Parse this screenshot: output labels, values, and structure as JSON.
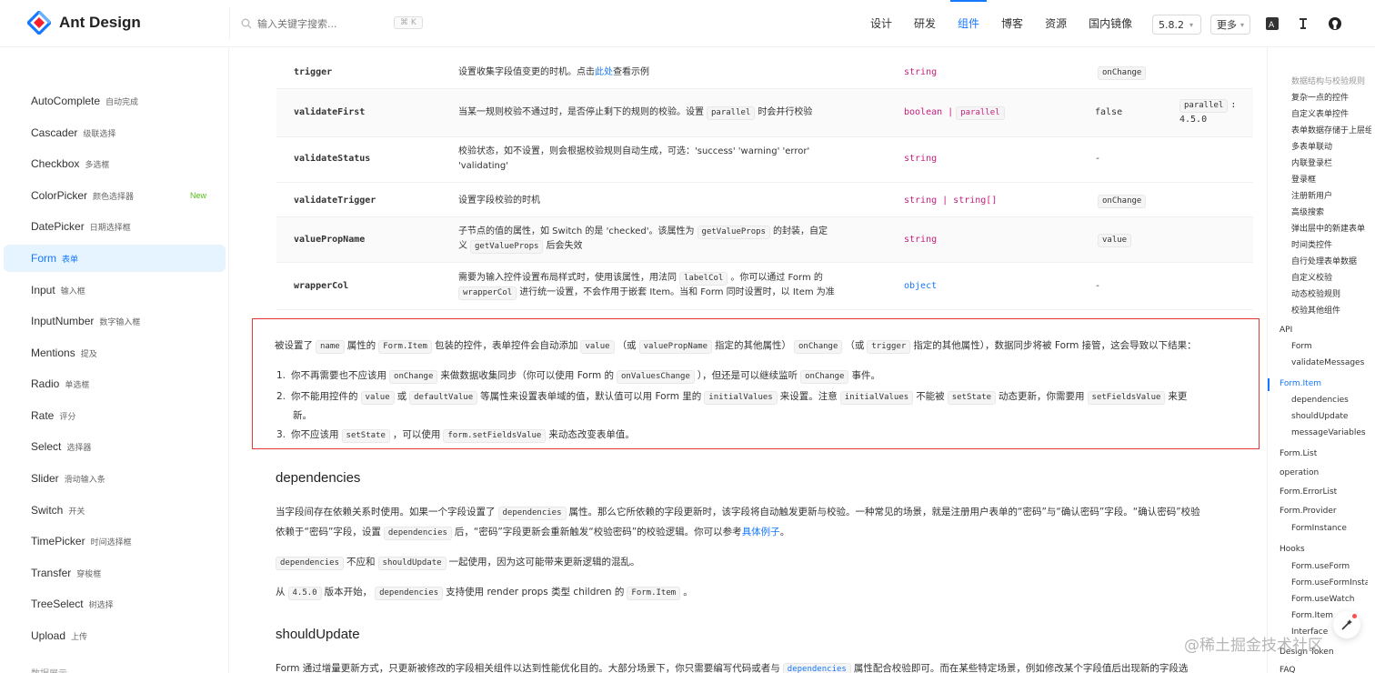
{
  "header": {
    "brand": "Ant Design",
    "search_placeholder": "输入关键字搜索...",
    "kbd": "⌘ K",
    "nav": [
      "设计",
      "研发",
      "组件",
      "博客",
      "资源",
      "国内镜像"
    ],
    "active_nav": "组件",
    "version": "5.8.2",
    "more": "更多",
    "brand_color": "#1677ff",
    "icons": [
      "language-icon",
      "direction-icon",
      "github-icon"
    ]
  },
  "sidebar": {
    "items": [
      {
        "label": "AutoComplete",
        "cn": "自动完成"
      },
      {
        "label": "Cascader",
        "cn": "级联选择"
      },
      {
        "label": "Checkbox",
        "cn": "多选框"
      },
      {
        "label": "ColorPicker",
        "cn": "颜色选择器",
        "badge": "New"
      },
      {
        "label": "DatePicker",
        "cn": "日期选择框"
      },
      {
        "label": "Form",
        "cn": "表单"
      },
      {
        "label": "Input",
        "cn": "输入框"
      },
      {
        "label": "InputNumber",
        "cn": "数字输入框"
      },
      {
        "label": "Mentions",
        "cn": "提及"
      },
      {
        "label": "Radio",
        "cn": "单选框"
      },
      {
        "label": "Rate",
        "cn": "评分"
      },
      {
        "label": "Select",
        "cn": "选择器"
      },
      {
        "label": "Slider",
        "cn": "滑动输入条"
      },
      {
        "label": "Switch",
        "cn": "开关"
      },
      {
        "label": "TimePicker",
        "cn": "时间选择框"
      },
      {
        "label": "Transfer",
        "cn": "穿梭框"
      },
      {
        "label": "TreeSelect",
        "cn": "树选择"
      },
      {
        "label": "Upload",
        "cn": "上传"
      },
      {
        "label": "数据展示",
        "cn": ""
      }
    ],
    "active": "Form"
  },
  "table": {
    "rows": [
      {
        "prop": "trigger",
        "desc_a": "设置收集字段值变更的时机。点击",
        "desc_link": "此处",
        "desc_b": "查看示例",
        "type": "string",
        "default": "onChange",
        "version": ""
      },
      {
        "prop": "validateFirst",
        "desc_a": "当某一规则校验不通过时，是否停止剩下的规则的校验。设置",
        "code_a": "parallel",
        "desc_b": "时会并行校验",
        "type_a": "boolean |",
        "type_code": "parallel",
        "default": "false",
        "version_code": "parallel",
        "version_b": ":",
        "version_c": "4.5.0"
      },
      {
        "prop": "validateStatus",
        "line1": "校验状态，如不设置，则会根据校验规则自动生成，可选：'success' 'warning' 'error'",
        "line2": "'validating'",
        "type": "string",
        "default": "-"
      },
      {
        "prop": "validateTrigger",
        "desc": "设置字段校验的时机",
        "type": "string | string[]",
        "default": "onChange"
      },
      {
        "prop": "valuePropName",
        "line1a": "子节点的值的属性，如 Switch 的是 'checked'。该属性为",
        "code1": "getValueProps",
        "line1b": "的封装，自定",
        "line2a": "义",
        "code2": "getValueProps",
        "line2b": "后会失效",
        "type": "string",
        "default": "value"
      },
      {
        "prop": "wrapperCol",
        "line1a": "需要为输入控件设置布局样式时，使用该属性，用法同",
        "code1": "labelCol",
        "line1b": "。你可以通过 Form 的",
        "code2": "wrapperCol",
        "line2b": "进行统一设置，不会作用于嵌套 Item。当和 Form 同时设置时，以 Item 为准",
        "type": "object",
        "default": "-"
      }
    ]
  },
  "notice": {
    "intro": [
      "被设置了",
      "name",
      "属性的",
      "Form.Item",
      "包装的控件，表单控件会自动添加",
      "value",
      "（或",
      "valuePropName",
      "指定的其他属性）",
      "onChange",
      "（或",
      "trigger",
      "指定的其他属性），数据同步将被 Form 接管，这会导致以下结果："
    ],
    "li1": [
      "你不再需要也不应该用",
      "onChange",
      "来做数据收集同步（你可以使用 Form 的",
      "onValuesChange",
      "），但还是可以继续监听",
      "onChange",
      "事件。"
    ],
    "li2": [
      "你不能用控件的",
      "value",
      "或",
      "defaultValue",
      "等属性来设置表单域的值，默认值可以用 Form 里的",
      "initialValues",
      "来设置。注意",
      "initialValues",
      "不能被",
      "setState",
      "动态更新，你需要用",
      "setFieldsValue",
      "来更"
    ],
    "li2b": "新。",
    "li3": [
      "你不应该用",
      "setState",
      "，可以使用",
      "form.setFieldsValue",
      "来动态改变表单值。"
    ],
    "nums": [
      "1.",
      "2.",
      "3."
    ]
  },
  "dependencies": {
    "title": "dependencies",
    "p1a": "当字段间存在依赖关系时使用。如果一个字段设置了",
    "p1code": "dependencies",
    "p1b": "属性。那么它所依赖的字段更新时，该字段将自动触发更新与校验。一种常见的场景，就是注册用户表单的“密码”与“确认密码”字段。“确认密码”校验",
    "p2a": "依赖于“密码”字段，设置",
    "p2code": "dependencies",
    "p2b": "后，“密码”字段更新会重新触发“校验密码”的校验逻辑。你可以参考",
    "p2link": "具体例子",
    "p2c": "。",
    "p3code1": "dependencies",
    "p3a": "不应和",
    "p3code2": "shouldUpdate",
    "p3b": "一起使用，因为这可能带来更新逻辑的混乱。",
    "p4a": "从",
    "p4code1": "4.5.0",
    "p4b": "版本开始，",
    "p4code2": "dependencies",
    "p4c": "支持使用 render props 类型 children 的",
    "p4code3": "Form.Item",
    "p4d": "。"
  },
  "shouldUpdate": {
    "title": "shouldUpdate",
    "p1a": "Form 通过增量更新方式，只更新被修改的字段相关组件以达到性能优化目的。大部分场景下，你只需要编写代码或者与",
    "p1code": "dependencies",
    "p1b": "属性配合校验即可。而在某些特定场景，例如修改某个字段值后出现新的字段选"
  },
  "toc": {
    "items": [
      "数据结构与校验规则",
      "复杂一点的控件",
      "自定义表单控件",
      "表单数据存储于上层组件",
      "多表单联动",
      "内联登录栏",
      "登录框",
      "注册新用户",
      "高级搜索",
      "弹出层中的新建表单",
      "时间类控件",
      "自行处理表单数据",
      "自定义校验",
      "动态校验规则",
      "校验其他组件",
      "API",
      "Form",
      "validateMessages",
      "Form.Item",
      "dependencies",
      "shouldUpdate",
      "messageVariables",
      "Form.List",
      "operation",
      "Form.ErrorList",
      "Form.Provider",
      "FormInstance",
      "Hooks",
      "Form.useForm",
      "Form.useFormInstance",
      "Form.useWatch",
      "Form.Item.useStatus",
      "Interface",
      "Design Token",
      "FAQ"
    ],
    "active": "Form.Item"
  },
  "watermark": "@稀土掘金技术社区"
}
